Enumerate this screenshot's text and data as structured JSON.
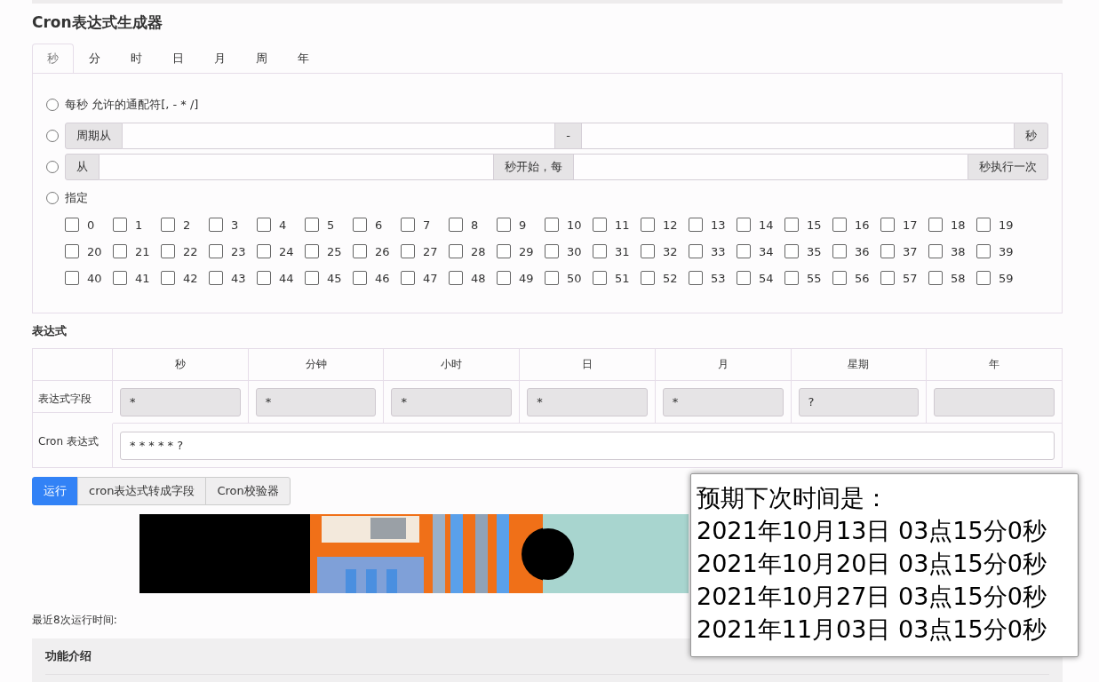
{
  "title": "Cron表达式生成器",
  "tabs": [
    {
      "label": "秒",
      "selected": true
    },
    {
      "label": "分",
      "selected": false
    },
    {
      "label": "时",
      "selected": false
    },
    {
      "label": "日",
      "selected": false
    },
    {
      "label": "月",
      "selected": false
    },
    {
      "label": "周",
      "selected": false
    },
    {
      "label": "年",
      "selected": false
    }
  ],
  "options": [
    {
      "kind": "text",
      "label": "每秒 允许的通配符[, - * /]",
      "selected": false
    },
    {
      "kind": "group",
      "parts": [
        "周期从",
        "-",
        "秒"
      ],
      "selected": false
    },
    {
      "kind": "group",
      "parts": [
        "从",
        "秒开始，每",
        "秒执行一次"
      ],
      "selected": false
    },
    {
      "kind": "text",
      "label": "指定",
      "selected": false
    }
  ],
  "checkboxes": [
    {
      "label": "0",
      "checked": false
    },
    {
      "label": "1",
      "checked": false
    },
    {
      "label": "2",
      "checked": false
    },
    {
      "label": "3",
      "checked": false
    },
    {
      "label": "4",
      "checked": false
    },
    {
      "label": "5",
      "checked": false
    },
    {
      "label": "6",
      "checked": false
    },
    {
      "label": "7",
      "checked": false
    },
    {
      "label": "8",
      "checked": false
    },
    {
      "label": "9",
      "checked": false
    },
    {
      "label": "10",
      "checked": false
    },
    {
      "label": "11",
      "checked": false
    },
    {
      "label": "12",
      "checked": false
    },
    {
      "label": "13",
      "checked": false
    },
    {
      "label": "14",
      "checked": false
    },
    {
      "label": "15",
      "checked": false
    },
    {
      "label": "16",
      "checked": false
    },
    {
      "label": "17",
      "checked": false
    },
    {
      "label": "18",
      "checked": false
    },
    {
      "label": "19",
      "checked": false
    },
    {
      "label": "20",
      "checked": false
    },
    {
      "label": "21",
      "checked": false
    },
    {
      "label": "22",
      "checked": false
    },
    {
      "label": "23",
      "checked": false
    },
    {
      "label": "24",
      "checked": false
    },
    {
      "label": "25",
      "checked": false
    },
    {
      "label": "26",
      "checked": false
    },
    {
      "label": "27",
      "checked": false
    },
    {
      "label": "28",
      "checked": false
    },
    {
      "label": "29",
      "checked": false
    },
    {
      "label": "30",
      "checked": false
    },
    {
      "label": "31",
      "checked": false
    },
    {
      "label": "32",
      "checked": false
    },
    {
      "label": "33",
      "checked": false
    },
    {
      "label": "34",
      "checked": false
    },
    {
      "label": "35",
      "checked": false
    },
    {
      "label": "36",
      "checked": false
    },
    {
      "label": "37",
      "checked": false
    },
    {
      "label": "38",
      "checked": false
    },
    {
      "label": "39",
      "checked": false
    },
    {
      "label": "40",
      "checked": false
    },
    {
      "label": "41",
      "checked": false
    },
    {
      "label": "42",
      "checked": false
    },
    {
      "label": "43",
      "checked": false
    },
    {
      "label": "44",
      "checked": false
    },
    {
      "label": "45",
      "checked": false
    },
    {
      "label": "46",
      "checked": false
    },
    {
      "label": "47",
      "checked": false
    },
    {
      "label": "48",
      "checked": false
    },
    {
      "label": "49",
      "checked": false
    },
    {
      "label": "50",
      "checked": false
    },
    {
      "label": "51",
      "checked": false
    },
    {
      "label": "52",
      "checked": false
    },
    {
      "label": "53",
      "checked": false
    },
    {
      "label": "54",
      "checked": false
    },
    {
      "label": "55",
      "checked": false
    },
    {
      "label": "56",
      "checked": false
    },
    {
      "label": "57",
      "checked": false
    },
    {
      "label": "58",
      "checked": false
    },
    {
      "label": "59",
      "checked": false
    }
  ],
  "expression": {
    "heading": "表达式",
    "columns": [
      "秒",
      "分钟",
      "小时",
      "日",
      "月",
      "星期",
      "年"
    ],
    "field_label": "表达式字段",
    "fields": [
      "*",
      "*",
      "*",
      "*",
      "*",
      "?"
    ],
    "cron_label": "Cron 表达式",
    "cron_value": "* * * * * ?"
  },
  "buttons": [
    {
      "label": "运行",
      "kind": "primary"
    },
    {
      "label": "cron表达式转成字段",
      "kind": "default"
    },
    {
      "label": "Cron校验器",
      "kind": "default"
    }
  ],
  "recent_runs_label": "最近8次运行时间:",
  "info_panel": {
    "title": "功能介绍"
  },
  "popup": {
    "title": "预期下次时间是：",
    "lines": [
      "2021年10月13日 03点15分0秒",
      "2021年10月20日 03点15分0秒",
      "2021年10月27日 03点15分0秒",
      "2021年11月03日 03点15分0秒"
    ]
  }
}
